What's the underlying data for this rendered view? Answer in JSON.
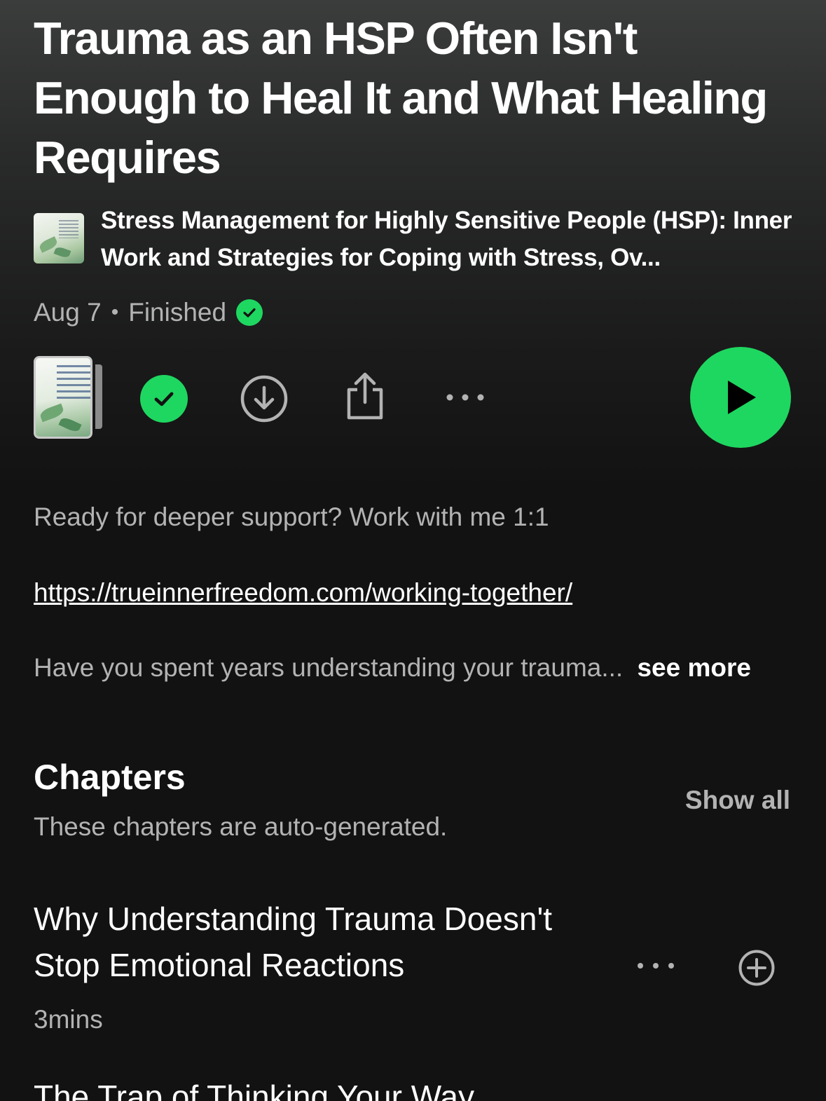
{
  "episode": {
    "title": "Trauma as an HSP Often Isn't Enough to Heal It and What Healing Requires"
  },
  "show": {
    "name": "Stress Management for Highly Sensitive People (HSP): Inner Work and Strategies for Coping with Stress, Ov..."
  },
  "meta": {
    "date": "Aug 7",
    "separator": "•",
    "status": "Finished"
  },
  "actions": {
    "icons": [
      "cover-art",
      "check-circle-icon",
      "download-icon",
      "share-icon",
      "more-icon",
      "play-icon"
    ]
  },
  "description": {
    "line1": "Ready for deeper support? Work with me 1:1",
    "link": "https://trueinnerfreedom.com/working-together/",
    "line3": "Have you spent years understanding your trauma...",
    "see_more": "see more"
  },
  "chapters": {
    "title": "Chapters",
    "subtitle": "These chapters are auto-generated.",
    "show_all": "Show all",
    "items": [
      {
        "title": "Why Understanding Trauma Doesn't Stop Emotional Reactions",
        "duration": "3mins"
      },
      {
        "title": "The Trap of Thinking Your Way"
      }
    ]
  },
  "colors": {
    "accent": "#1ed760",
    "background": "#121212",
    "secondary_text": "#b3b3b3"
  }
}
